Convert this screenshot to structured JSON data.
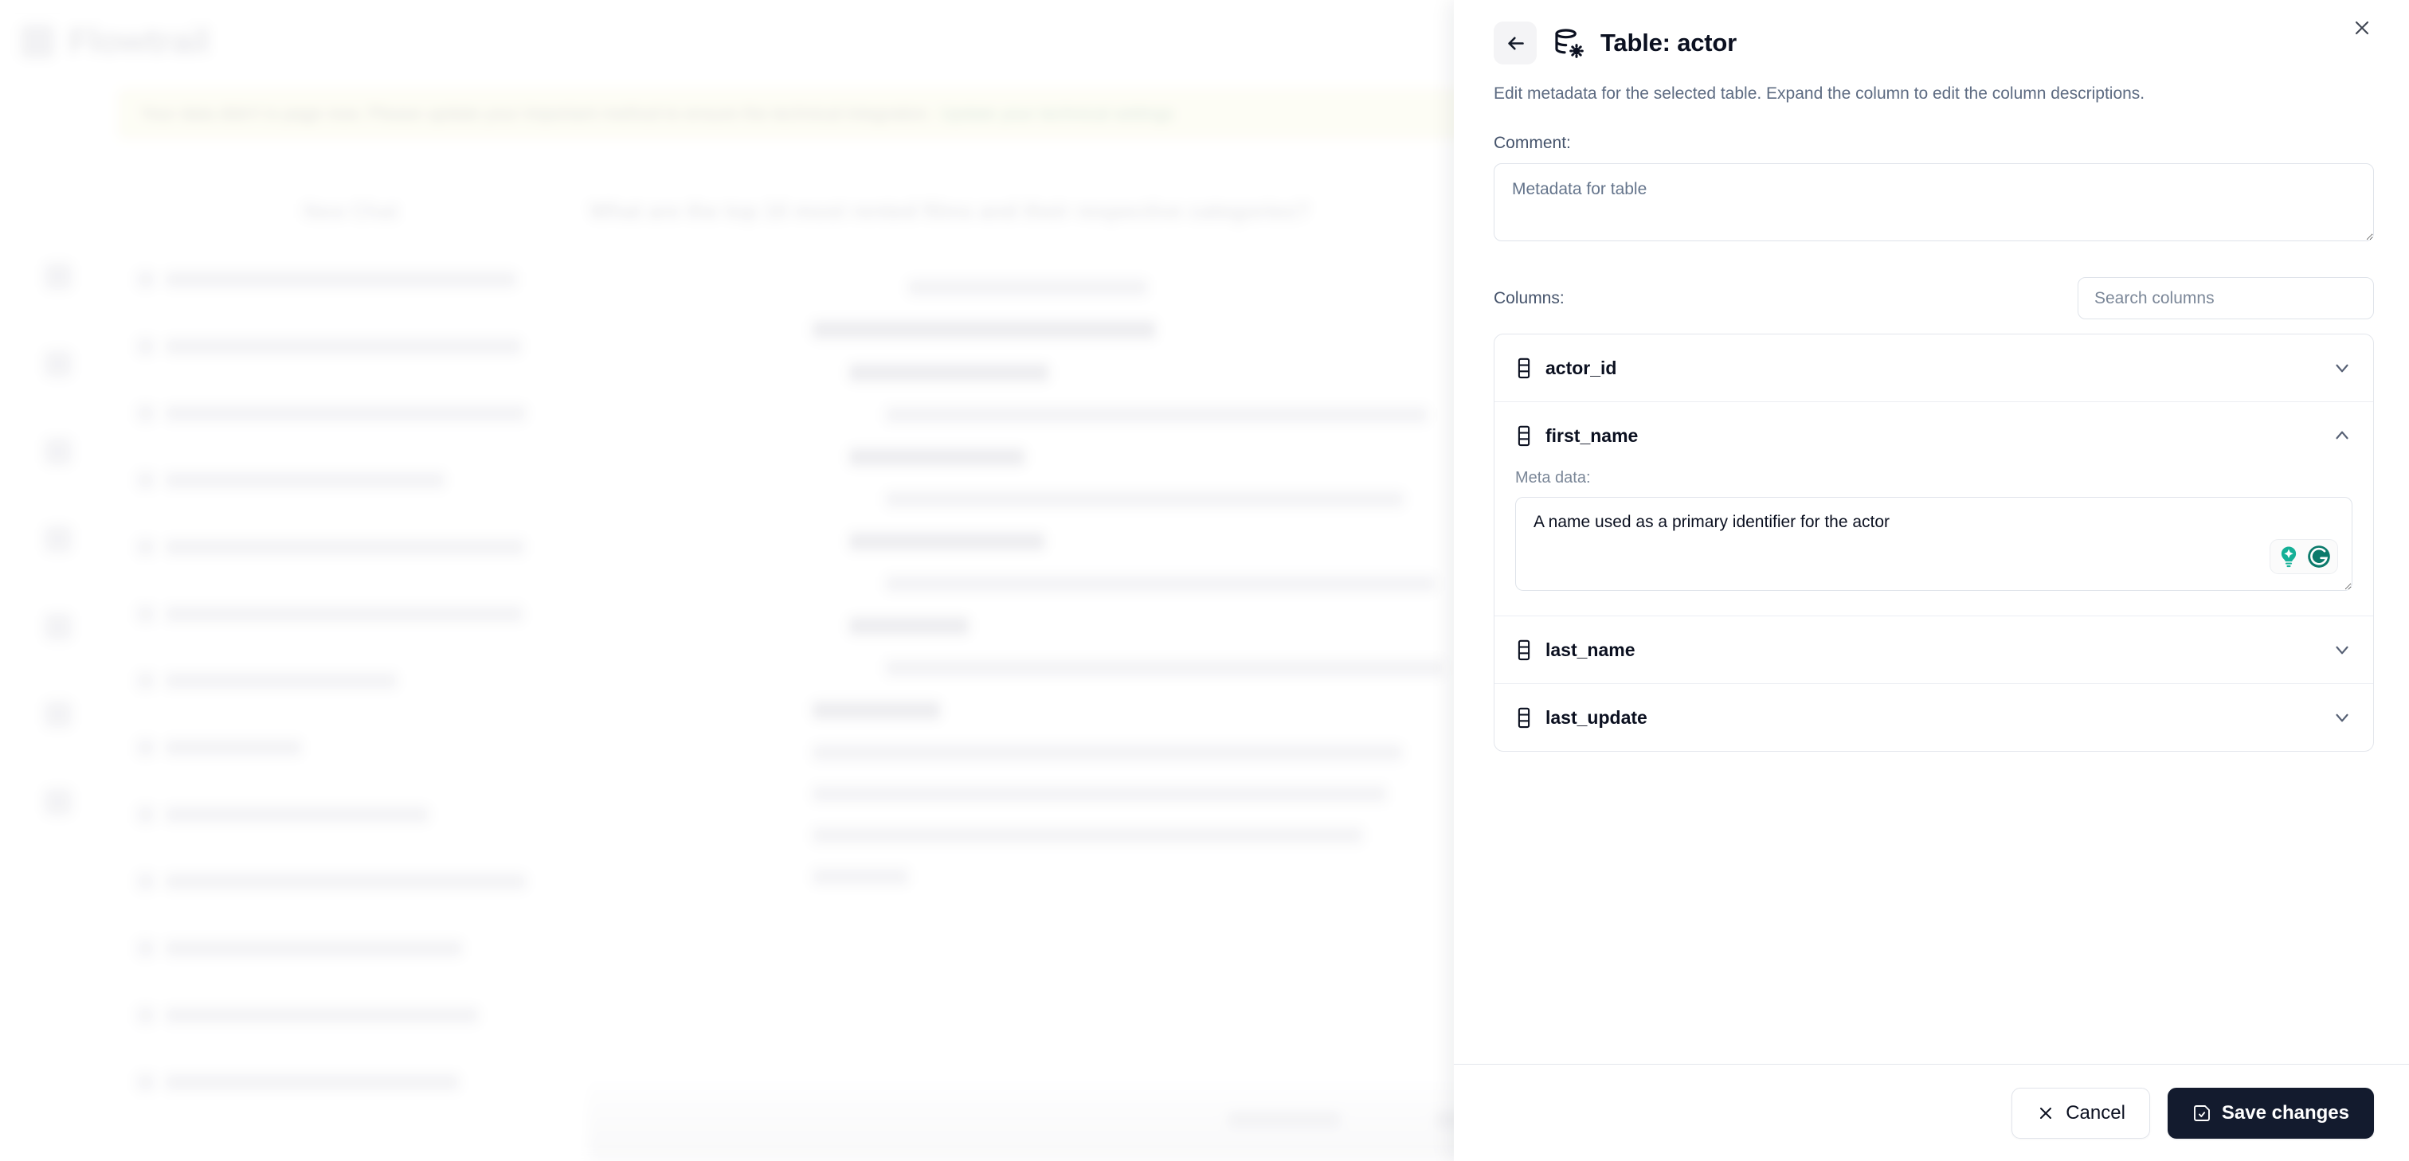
{
  "background_app": {
    "logo_text": "Flowtrail",
    "banner_text": "Your data didn't is page now. Please update your important method to ensure the technical integration.",
    "banner_link_text": "Update your technical settings",
    "chat_panel_title": "New Chat",
    "chat_items": [
      "What are the top 10 most rented...",
      "What are the top 10 rental movies...",
      "How only this of employees who w...",
      "How that only has of employees...",
      "Which are the most popular mov...",
      "Which are the most expensive cu...",
      "How will the of movies",
      "List of films",
      "How was the out of movies",
      "List all movies made from rentals ...",
      "How may the top of movies",
      "Spe only the are of the movies",
      "How may the top of movies"
    ],
    "main_question": "What are the top 10 most rented films and their respective categories?",
    "bottom_bar_items": [
      "Powered",
      "New Chat",
      "Metadata"
    ]
  },
  "panel": {
    "header": {
      "back_icon": "arrow-left-icon",
      "table_icon": "database-settings-icon",
      "title": "Table: actor",
      "close_icon": "close-icon",
      "subtitle": "Edit metadata for the selected table. Expand the column to edit the column descriptions."
    },
    "comment": {
      "label": "Comment:",
      "value": "Metadata for table",
      "placeholder": "Metadata for table"
    },
    "columns_section": {
      "label": "Columns:",
      "search_placeholder": "Search columns",
      "search_value": ""
    },
    "columns": [
      {
        "name": "actor_id",
        "icon": "column-icon",
        "expanded": false,
        "chevron": "chevron-down-icon"
      },
      {
        "name": "first_name",
        "icon": "column-icon",
        "expanded": true,
        "chevron": "chevron-up-icon",
        "meta_label": "Meta data:",
        "meta_value": "A name used as a primary identifier for the actor",
        "assistant_badge": {
          "lightbulb_icon": "lightbulb-sparkle-icon",
          "grammarly_icon": "grammarly-g-icon",
          "color_light": "#15b097",
          "color_dark": "#0b7a6b"
        }
      },
      {
        "name": "last_name",
        "icon": "column-icon",
        "expanded": false,
        "chevron": "chevron-down-icon"
      },
      {
        "name": "last_update",
        "icon": "column-icon",
        "expanded": false,
        "chevron": "chevron-down-icon"
      }
    ],
    "footer": {
      "cancel_label": "Cancel",
      "cancel_icon": "close-icon",
      "save_label": "Save changes",
      "save_icon": "save-check-icon",
      "save_bg": "#131b2e"
    }
  }
}
